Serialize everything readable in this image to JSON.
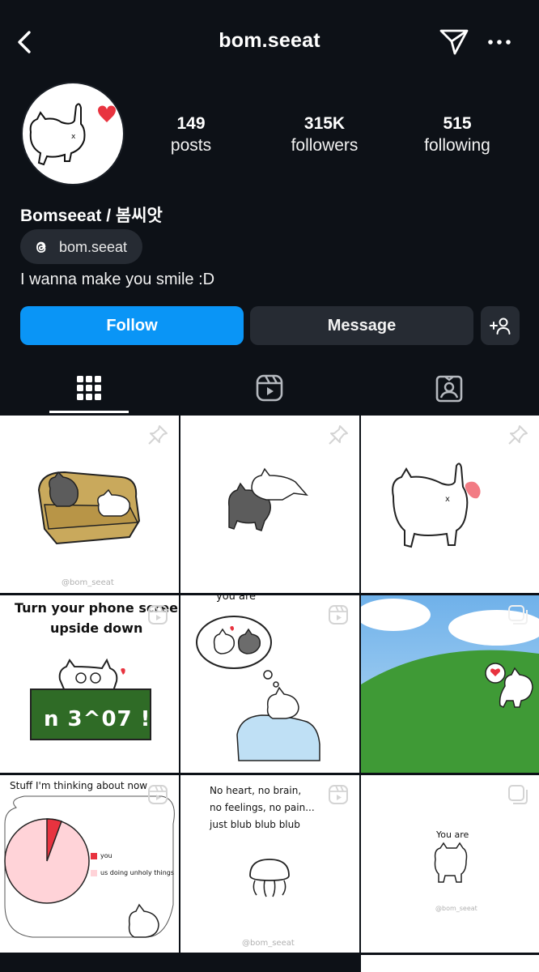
{
  "header": {
    "username": "bom.seeat",
    "back_icon": "chevron-left-icon",
    "send_icon": "paper-plane-icon",
    "more_icon": "more-dots-icon"
  },
  "profile": {
    "posts_count": "149",
    "posts_label": "posts",
    "followers_count": "315K",
    "followers_label": "followers",
    "following_count": "515",
    "following_label": "following",
    "full_name": "Bomseeat / 봄씨앗",
    "threads_handle": "bom.seeat",
    "bio": "I wanna make you smile :D"
  },
  "actions": {
    "follow_label": "Follow",
    "message_label": "Message",
    "add_user_icon": "add-user-icon",
    "follow_color": "#0a95f6"
  },
  "tabs": [
    {
      "name": "posts-grid",
      "icon": "grid-icon",
      "active": true
    },
    {
      "name": "reels",
      "icon": "reels-icon",
      "active": false
    },
    {
      "name": "tagged",
      "icon": "tagged-icon",
      "active": false
    }
  ],
  "posts": [
    {
      "type": "pinned",
      "watermark": "@bom_seeat"
    },
    {
      "type": "pinned"
    },
    {
      "type": "pinned"
    },
    {
      "type": "reel",
      "text_line1": "Turn your phone screen",
      "text_line2": "upside down",
      "board_text": "n 3^07 !"
    },
    {
      "type": "reel",
      "top_text": "you are"
    },
    {
      "type": "carousel"
    },
    {
      "type": "reel",
      "title": "Stuff I'm thinking about now",
      "legend_1": "you",
      "legend_2": "us doing unholy things"
    },
    {
      "type": "reel",
      "line1": "No heart, no brain,",
      "line2": "no feelings, no pain...",
      "line3": "just blub blub blub",
      "watermark": "@bom_seeat"
    },
    {
      "type": "carousel",
      "text": "You are",
      "watermark": "@bom_seeat"
    }
  ]
}
